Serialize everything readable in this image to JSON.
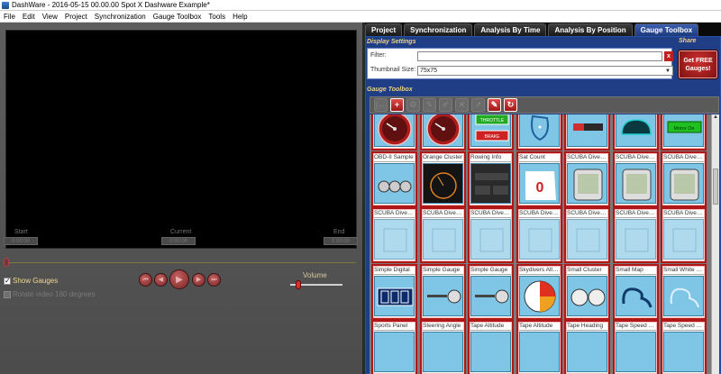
{
  "window": {
    "title": "DashWare - 2016-05-15 00.00.00 Spot X Dashware Example*"
  },
  "menu": [
    "File",
    "Edit",
    "View",
    "Project",
    "Synchronization",
    "Gauge Toolbox",
    "Tools",
    "Help"
  ],
  "player": {
    "start_label": "Start",
    "start_value": "0:00:00",
    "current_label": "Current",
    "current_value": "0:00:00",
    "end_label": "End",
    "end_value": "0:00:00",
    "volume_label": "Volume",
    "show_gauges_label": "Show Gauges",
    "show_gauges_checked": true,
    "rotate_label": "Rotate video 180 degrees",
    "rotate_checked": false
  },
  "tabs": [
    {
      "label": "Project",
      "active": false
    },
    {
      "label": "Synchronization",
      "active": false
    },
    {
      "label": "Analysis By Time",
      "active": false
    },
    {
      "label": "Analysis By Position",
      "active": false
    },
    {
      "label": "Gauge Toolbox",
      "active": true
    }
  ],
  "display_settings": {
    "heading": "Display Settings",
    "filter_label": "Filter:",
    "filter_value": "",
    "clear_icon": "x",
    "thumbnail_label": "Thumbnail Size:",
    "thumbnail_value": "75x75"
  },
  "share": {
    "heading": "Share",
    "button_label": "Get FREE Gauges!"
  },
  "toolbox": {
    "heading": "Gauge Toolbox",
    "toolbar_icons": [
      "first-icon",
      "add-icon",
      "settings-icon",
      "tools-icon",
      "edit-icon",
      "delete-icon",
      "export-icon",
      "import-icon",
      "refresh-icon"
    ],
    "gauges": [
      {
        "name": "",
        "thumb": "tach-red"
      },
      {
        "name": "",
        "thumb": "speedo-red"
      },
      {
        "name": "",
        "thumb": "throttle-brake"
      },
      {
        "name": "",
        "thumb": "map-blue"
      },
      {
        "name": "",
        "thumb": "bar-red"
      },
      {
        "name": "",
        "thumb": "teal-dash"
      },
      {
        "name": "",
        "thumb": "motor-on"
      },
      {
        "name": "OBD-II Sample",
        "thumb": "obd"
      },
      {
        "name": "Orange Cluster",
        "thumb": "orange"
      },
      {
        "name": "Rowing Info",
        "thumb": "rowing"
      },
      {
        "name": "Sat Count",
        "thumb": "satcount"
      },
      {
        "name": "SCUBA Dive Computer",
        "thumb": "scuba"
      },
      {
        "name": "SCUBA Dive Computer",
        "thumb": "scuba"
      },
      {
        "name": "SCUBA Dive Computer",
        "thumb": "scuba"
      },
      {
        "name": "SCUBA Dive Computer",
        "thumb": "faded"
      },
      {
        "name": "SCUBA Dive Computer",
        "thumb": "faded"
      },
      {
        "name": "SCUBA Dive Computer",
        "thumb": "faded"
      },
      {
        "name": "SCUBA Dive Computer",
        "thumb": "faded"
      },
      {
        "name": "SCUBA Dive Computer",
        "thumb": "faded"
      },
      {
        "name": "SCUBA Dive Computer",
        "thumb": "faded"
      },
      {
        "name": "SCUBA Dive Computer",
        "thumb": "faded"
      },
      {
        "name": "Simple Digital",
        "thumb": "digital"
      },
      {
        "name": "Simple Gauge",
        "thumb": "simple"
      },
      {
        "name": "Simple Gauge",
        "thumb": "simple"
      },
      {
        "name": "Skydivers Altimeter",
        "thumb": "altimeter"
      },
      {
        "name": "Small Cluster",
        "thumb": "cluster"
      },
      {
        "name": "Small Map",
        "thumb": "smallmap"
      },
      {
        "name": "Small White Map",
        "thumb": "whitemap"
      },
      {
        "name": "Sports Panel",
        "thumb": "plain"
      },
      {
        "name": "Steering Angle",
        "thumb": "plain"
      },
      {
        "name": "Tape Altitude",
        "thumb": "plain"
      },
      {
        "name": "Tape Altitude",
        "thumb": "plain"
      },
      {
        "name": "Tape Heading",
        "thumb": "plain"
      },
      {
        "name": "Tape Speed Knots",
        "thumb": "plain"
      },
      {
        "name": "Tape Speed Kph",
        "thumb": "plain"
      }
    ],
    "throttle_text": "THROTTLE",
    "brake_text": "BRAKE",
    "motor_text": "Motor On",
    "sat_value": "0"
  },
  "colors": {
    "accent": "#b01818",
    "tab_active": "#2d4f9e",
    "panel": "#1f3e86"
  }
}
